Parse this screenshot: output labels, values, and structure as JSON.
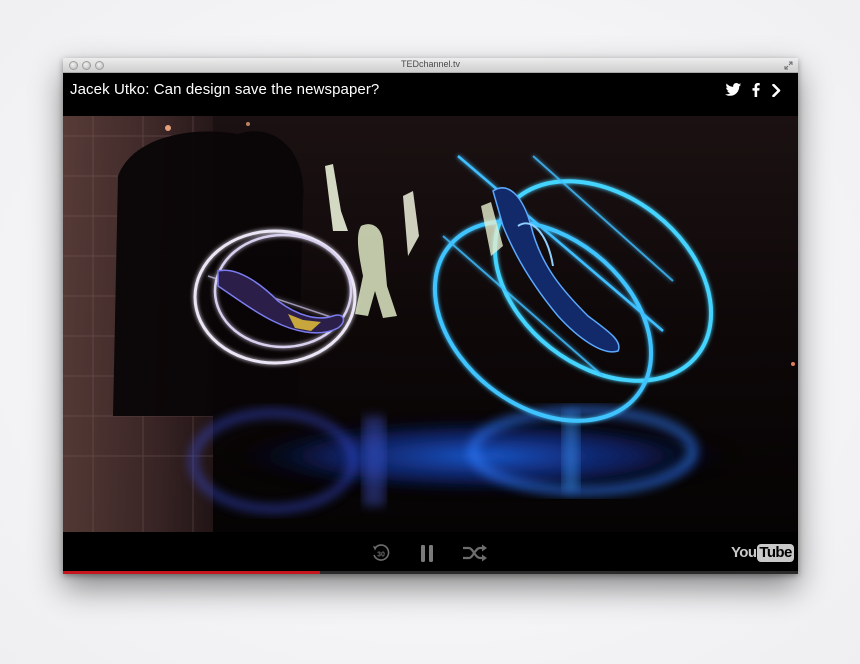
{
  "window": {
    "title": "TEDchannel.tv"
  },
  "player": {
    "video_title": "Jacek Utko: Can design save the newspaper?",
    "progress_fraction": 0.35,
    "progress_color": "#c4161c"
  },
  "share": {
    "icons": [
      "twitter-icon",
      "facebook-icon",
      "chevron-right-icon"
    ]
  },
  "controls": {
    "icons": [
      "rewind-30-icon",
      "pause-icon",
      "shuffle-icon"
    ],
    "rewind_seconds": "30"
  },
  "branding": {
    "logo_text_1": "You",
    "logo_text_2": "Tube"
  },
  "colors": {
    "ring_white": "#e9e4f3",
    "ring_blue": "#3fd2ff",
    "background": "#000000"
  }
}
